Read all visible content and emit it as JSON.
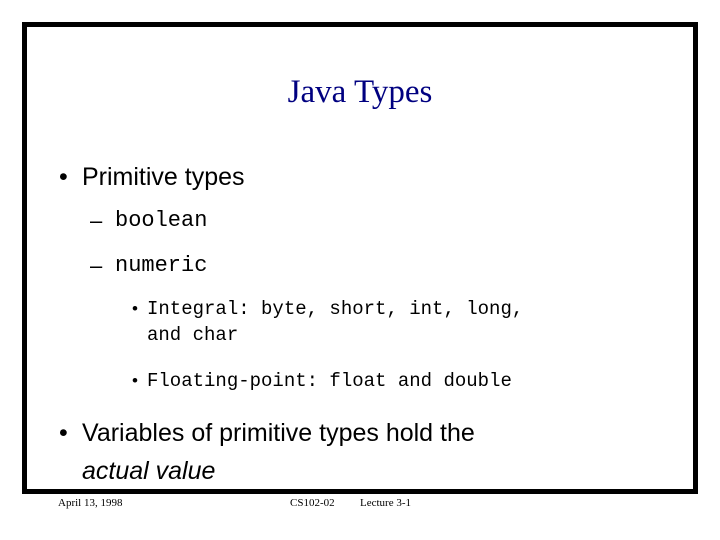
{
  "slide": {
    "title": "Java Types",
    "title_color": "#000080",
    "frame_color": "#000000",
    "background": "#ffffff",
    "bullets": {
      "level1_marker": "•",
      "level2_marker": "–",
      "level3_marker": "•"
    },
    "content": {
      "primitive_types": "Primitive types",
      "boolean": "boolean",
      "numeric": "numeric",
      "integral_line1": "Integral: byte, short, int, long,",
      "integral_line2": "and char",
      "floating_point": "Floating-point: float and double",
      "variables_line1": "Variables of primitive types hold the",
      "variables_line2": "actual value"
    }
  },
  "footer": {
    "date": "April 13, 1998",
    "course": "CS102-02",
    "lecture": "Lecture 3-1"
  }
}
